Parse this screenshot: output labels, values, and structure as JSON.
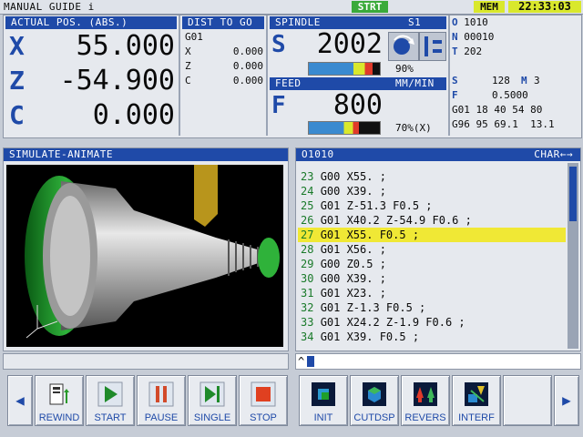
{
  "topbar": {
    "app_title": "MANUAL GUIDE i",
    "mode": "STRT",
    "mem": "MEM",
    "time": "22:33:03"
  },
  "actual_pos": {
    "title": "ACTUAL POS. (ABS.)",
    "axes": [
      {
        "name": "X",
        "value": "55.000"
      },
      {
        "name": "Z",
        "value": "-54.900"
      },
      {
        "name": "C",
        "value": "0.000"
      }
    ]
  },
  "dist_to_go": {
    "title": "DIST TO GO",
    "gcode": "G01",
    "axes": [
      {
        "name": "X",
        "value": "0.000"
      },
      {
        "name": "Z",
        "value": "0.000"
      },
      {
        "name": "C",
        "value": "0.000"
      }
    ]
  },
  "spindle": {
    "title": "SPINDLE",
    "id": "S1",
    "letter": "S",
    "value": "2002",
    "percent_text": "90%",
    "load_fraction": 0.9
  },
  "feed": {
    "title": "FEED",
    "unit": "MM/MIN",
    "letter": "F",
    "value": "800",
    "percent_text": "70%(X)",
    "load_fraction": 0.7
  },
  "info": {
    "o": {
      "label": "O",
      "value": "1010"
    },
    "n": {
      "label": "N",
      "value": "00010"
    },
    "t": {
      "label": "T",
      "value": "202"
    },
    "s_line": {
      "label": "S",
      "value": "128",
      "m_label": "M",
      "m_value": "3"
    },
    "f_line": {
      "label": "F",
      "value": "0.5000"
    },
    "g_line1": "G01 18 40 54 80",
    "g_line2": "G96 95 69.1  13.1"
  },
  "simulate": {
    "title": "SIMULATE-ANIMATE"
  },
  "program": {
    "title": "O1010",
    "char_label": "CHAR←→",
    "lines": [
      {
        "n": "23",
        "code": "G00 X55. ;"
      },
      {
        "n": "24",
        "code": "G00 X39. ;"
      },
      {
        "n": "25",
        "code": "G01 Z-51.3 F0.5 ;"
      },
      {
        "n": "26",
        "code": "G01 X40.2 Z-54.9 F0.6 ;"
      },
      {
        "n": "27",
        "code": "G01 X55. F0.5 ;",
        "active": true
      },
      {
        "n": "28",
        "code": "G01 X56. ;"
      },
      {
        "n": "29",
        "code": "G00 Z0.5 ;"
      },
      {
        "n": "30",
        "code": "G00 X39. ;"
      },
      {
        "n": "31",
        "code": "G01 X23. ;"
      },
      {
        "n": "32",
        "code": "G01 Z-1.3 F0.5 ;"
      },
      {
        "n": "33",
        "code": "G01 X24.2 Z-1.9 F0.6 ;"
      },
      {
        "n": "34",
        "code": "G01 X39. F0.5 ;"
      }
    ],
    "input_prompt": "^"
  },
  "softkeys": {
    "left": [
      {
        "label": "REWIND",
        "icon": "rewind-icon"
      },
      {
        "label": "START",
        "icon": "play-icon"
      },
      {
        "label": "PAUSE",
        "icon": "pause-icon"
      },
      {
        "label": "SINGLE",
        "icon": "single-step-icon"
      },
      {
        "label": "STOP",
        "icon": "stop-icon"
      }
    ],
    "right": [
      {
        "label": "INIT",
        "icon": "init-icon"
      },
      {
        "label": "CUTDSP",
        "icon": "cut-display-icon"
      },
      {
        "label": "REVERS",
        "icon": "reverse-icon"
      },
      {
        "label": "INTERF",
        "icon": "interference-icon"
      }
    ]
  },
  "colors": {
    "header_blue": "#1f4aa8",
    "highlight_yellow": "#f0e835",
    "status_green": "#3aaa3a",
    "accent_yellow": "#d9e82c"
  }
}
